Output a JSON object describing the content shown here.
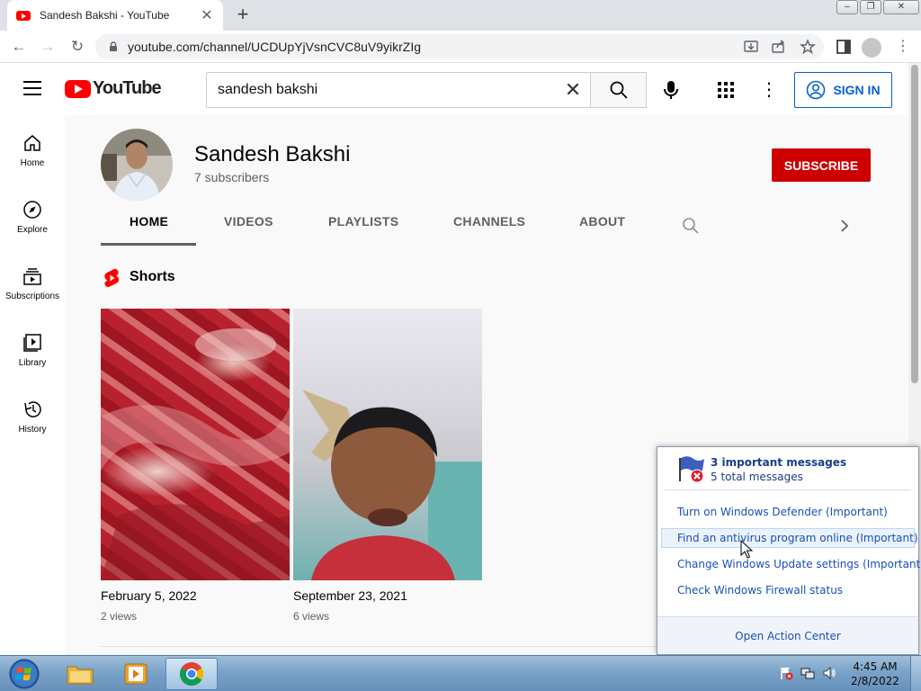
{
  "browser": {
    "tab_title": "Sandesh Bakshi - YouTube",
    "tab_close": "✕",
    "new_tab": "+",
    "url": "youtube.com/channel/UCDUpYjVsnCVC8uV9yikrZIg",
    "back": "←",
    "forward": "→",
    "reload": "↻",
    "menu": "⋮"
  },
  "youtube": {
    "logo_text": "YouTube",
    "search_value": "sandesh bakshi",
    "clear_icon": "✕",
    "more_icon": "⋮",
    "sign_in": "SIGN IN"
  },
  "sidebar": {
    "items": [
      {
        "label": "Home",
        "icon": "home-icon"
      },
      {
        "label": "Explore",
        "icon": "compass-icon"
      },
      {
        "label": "Subscriptions",
        "icon": "subscriptions-icon"
      },
      {
        "label": "Library",
        "icon": "library-icon"
      },
      {
        "label": "History",
        "icon": "history-icon"
      }
    ]
  },
  "channel": {
    "name": "Sandesh Bakshi",
    "subscribers": "7 subscribers",
    "subscribe": "SUBSCRIBE",
    "tabs": [
      "HOME",
      "VIDEOS",
      "PLAYLISTS",
      "CHANNELS",
      "ABOUT"
    ],
    "active_tab": "HOME"
  },
  "shorts": {
    "title": "Shorts",
    "videos": [
      {
        "date": "February 5, 2022",
        "views": "2 views"
      },
      {
        "date": "September 23, 2021",
        "views": "6 views"
      }
    ]
  },
  "notification": {
    "headline": "3 important messages",
    "subline": "5 total messages",
    "links": [
      "Turn on Windows Defender (Important)",
      "Find an antivirus program online (Important)",
      "Change Windows Update settings (Important)",
      "Check Windows Firewall status"
    ],
    "footer": "Open Action Center"
  },
  "taskbar": {
    "time": "4:45 AM",
    "date": "2/8/2022"
  },
  "colors": {
    "youtube_red": "#ff0000",
    "subscribe_red": "#cc0000",
    "link_blue": "#065fd4",
    "win_link": "#1c4fb4"
  }
}
